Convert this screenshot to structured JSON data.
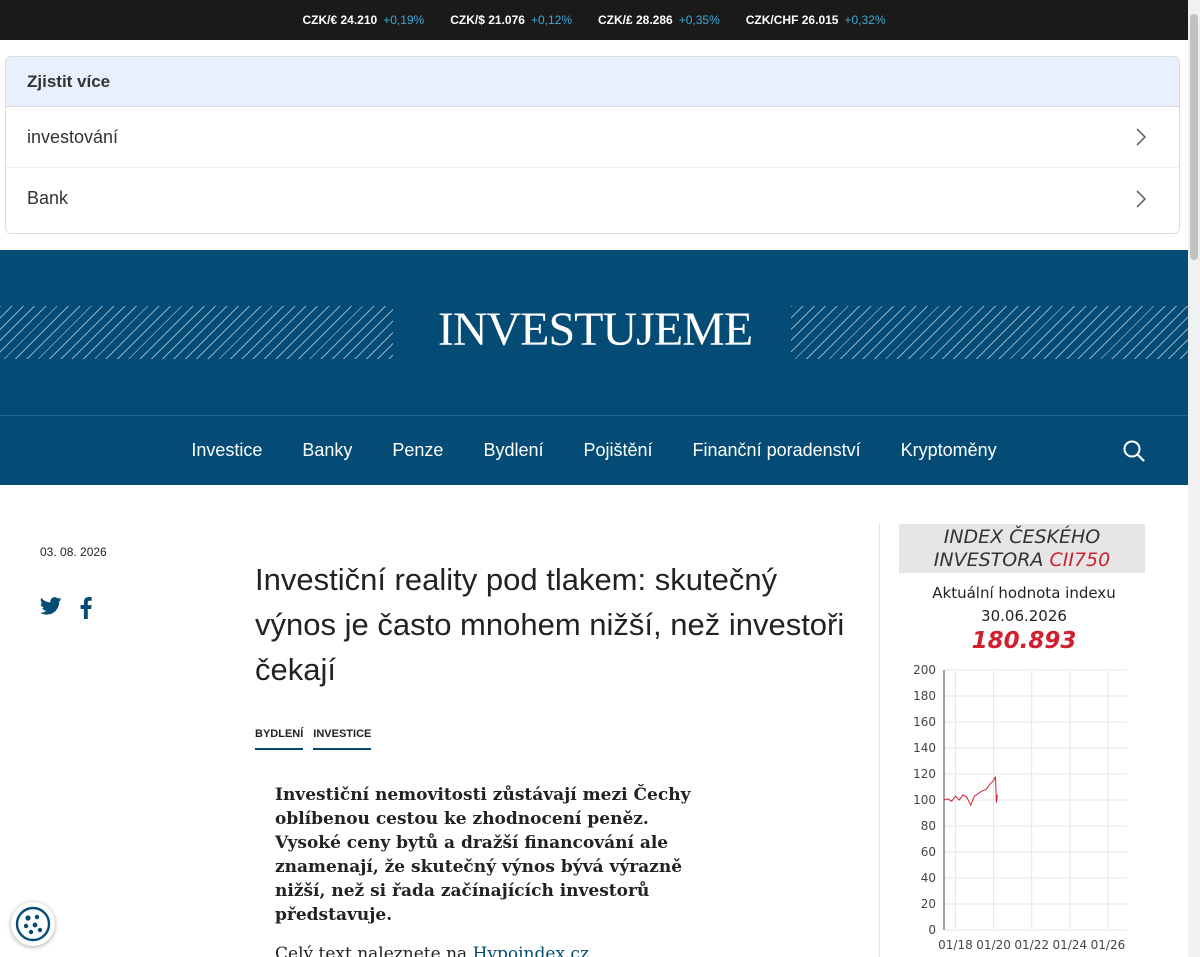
{
  "ticker": [
    {
      "pair": "CZK/€ 24.210",
      "change": "+0,19%"
    },
    {
      "pair": "CZK/$ 21.076",
      "change": "+0,12%"
    },
    {
      "pair": "CZK/£ 28.286",
      "change": "+0,35%"
    },
    {
      "pair": "CZK/CHF 26.015",
      "change": "+0,32%"
    }
  ],
  "more_box": {
    "title": "Zjistit více",
    "items": [
      {
        "label": "investování",
        "icon": "chevron-right-icon"
      },
      {
        "label": "Bank",
        "icon": "chevron-right-icon"
      }
    ]
  },
  "header": {
    "logo": "INVESTUJEME"
  },
  "nav": {
    "items": [
      "Investice",
      "Banky",
      "Penze",
      "Bydlení",
      "Pojištění",
      "Finanční poradenství",
      "Kryptoměny"
    ],
    "search_icon": "search-icon"
  },
  "article": {
    "date": "03. 08. 2026",
    "share_icons": [
      "twitter-icon",
      "facebook-icon"
    ],
    "headline": "Investiční reality pod tlakem: skutečný výnos je často mnohem nižší, než investoři čekají",
    "tags": [
      "BYDLENÍ",
      "INVESTICE"
    ],
    "perex": "Investiční nemovitosti zůstávají mezi Čechy oblíbenou cestou ke zhodnocení peněz. Vysoké ceny bytů a dražší financování ale znamenají, že skutečný výnos bývá výrazně nižší, než si řada začínajících investorů představuje.",
    "more_prefix": "Celý text naleznete na ",
    "more_link": "Hypoindex.cz"
  },
  "sidebar": {
    "index_title_1": "INDEX ČESKÉHO",
    "index_title_2": "INVESTORA ",
    "index_code": "CII750",
    "current_label": "Aktuální hodnota indexu",
    "current_date": "30.06.2026",
    "current_value": "180.893"
  },
  "colors": {
    "brand": "#044c75",
    "ticker_bg": "#1a1a1a",
    "ticker_change": "#3fa8d8",
    "index_red": "#d0202e"
  },
  "chart_data": {
    "type": "line",
    "ylim": [
      0,
      200
    ],
    "yticks": [
      0,
      20,
      40,
      60,
      80,
      100,
      120,
      140,
      160,
      180,
      200
    ],
    "xticks": [
      "01/18",
      "01/20",
      "01/22",
      "01/24",
      "01/26"
    ],
    "xrange": [
      2017.4,
      2027.0
    ],
    "grid": true,
    "series": [
      {
        "color": "#d0202e",
        "points": [
          [
            2017.4,
            100
          ],
          [
            2017.6,
            101
          ],
          [
            2017.8,
            99
          ],
          [
            2018.0,
            103
          ],
          [
            2018.2,
            100
          ],
          [
            2018.4,
            104
          ],
          [
            2018.6,
            102
          ],
          [
            2018.8,
            96
          ],
          [
            2019.0,
            103
          ],
          [
            2019.2,
            105
          ],
          [
            2019.4,
            107
          ],
          [
            2019.6,
            108
          ],
          [
            2019.8,
            112
          ],
          [
            2020.0,
            115
          ],
          [
            2020.1,
            118
          ],
          [
            2020.15,
            98
          ],
          [
            2020.2,
            104
          ]
        ]
      }
    ]
  }
}
